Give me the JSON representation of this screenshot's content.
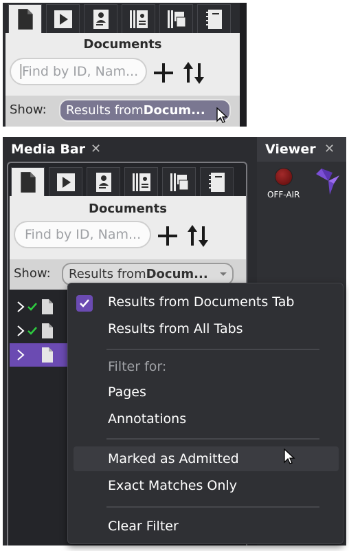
{
  "colors": {
    "accent": "#6b4bb2",
    "panel_dark": "#2b2c30",
    "light_area": "#ececec",
    "select_bg": "#7a7791",
    "check_green": "#2ecc40",
    "off_air_red": "#8b1a1a"
  },
  "tabs": [
    {
      "icon": "document-icon",
      "active": true
    },
    {
      "icon": "play-icon",
      "active": false
    },
    {
      "icon": "deposition-icon",
      "active": false
    },
    {
      "icon": "exhibit-binder-icon",
      "active": false
    },
    {
      "icon": "stacked-pages-icon",
      "active": false
    },
    {
      "icon": "notebook-icon",
      "active": false
    }
  ],
  "documents_title": "Documents",
  "search": {
    "placeholder_top": "Find by ID, Nam...",
    "placeholder_bottom": "Find by ID, Nam..."
  },
  "show": {
    "label": "Show:",
    "value_prefix": "Results from ",
    "value_bold": "Docum..."
  },
  "panel_tabs": {
    "media_bar": "Media Bar",
    "viewer": "Viewer",
    "close": "✕"
  },
  "viewer": {
    "status": "OFF-AIR"
  },
  "tree": [
    {
      "checked": true,
      "selected": false
    },
    {
      "checked": true,
      "selected": false
    },
    {
      "checked": false,
      "selected": true
    }
  ],
  "menu": {
    "results_docs_tab": "Results from Documents Tab",
    "results_all_tabs": "Results from All Tabs",
    "filter_for": "Filter for:",
    "pages": "Pages",
    "annotations": "Annotations",
    "marked_admitted": "Marked as Admitted",
    "exact_matches": "Exact Matches Only",
    "clear_filter": "Clear Filter"
  }
}
